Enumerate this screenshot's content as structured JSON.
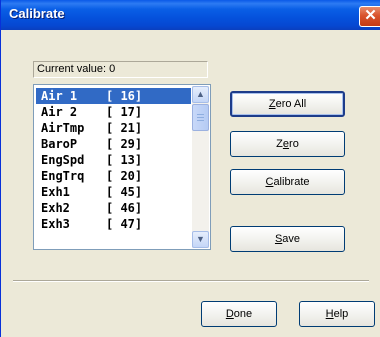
{
  "window": {
    "title": "Calibrate",
    "close_glyph": "✕"
  },
  "current_value": {
    "label": "Current value:",
    "value": "0"
  },
  "list": {
    "items": [
      {
        "name": "Air 1",
        "value": "[ 16]",
        "selected": true
      },
      {
        "name": "Air 2",
        "value": "[ 17]",
        "selected": false
      },
      {
        "name": "AirTmp",
        "value": "[ 21]",
        "selected": false
      },
      {
        "name": "BaroP",
        "value": "[ 29]",
        "selected": false
      },
      {
        "name": "EngSpd",
        "value": "[ 13]",
        "selected": false
      },
      {
        "name": "EngTrq",
        "value": "[ 20]",
        "selected": false
      },
      {
        "name": "Exh1",
        "value": "[ 45]",
        "selected": false
      },
      {
        "name": "Exh2",
        "value": "[ 46]",
        "selected": false
      },
      {
        "name": "Exh3",
        "value": "[ 47]",
        "selected": false
      }
    ],
    "scroll_up_glyph": "▲",
    "scroll_down_glyph": "▼"
  },
  "buttons": {
    "zero_all": {
      "mnemonic": "Z",
      "rest": "ero All"
    },
    "zero": {
      "pre": "Z",
      "mnemonic": "e",
      "rest": "ro"
    },
    "calibrate": {
      "mnemonic": "C",
      "rest": "alibrate"
    },
    "save": {
      "mnemonic": "S",
      "rest": "ave"
    },
    "done": {
      "mnemonic": "D",
      "rest": "one"
    },
    "help": {
      "mnemonic": "H",
      "rest": "elp"
    }
  },
  "colors": {
    "titlebar": "#0a5fe6",
    "selection": "#316ac5",
    "dialog_bg": "#ece9d8"
  }
}
